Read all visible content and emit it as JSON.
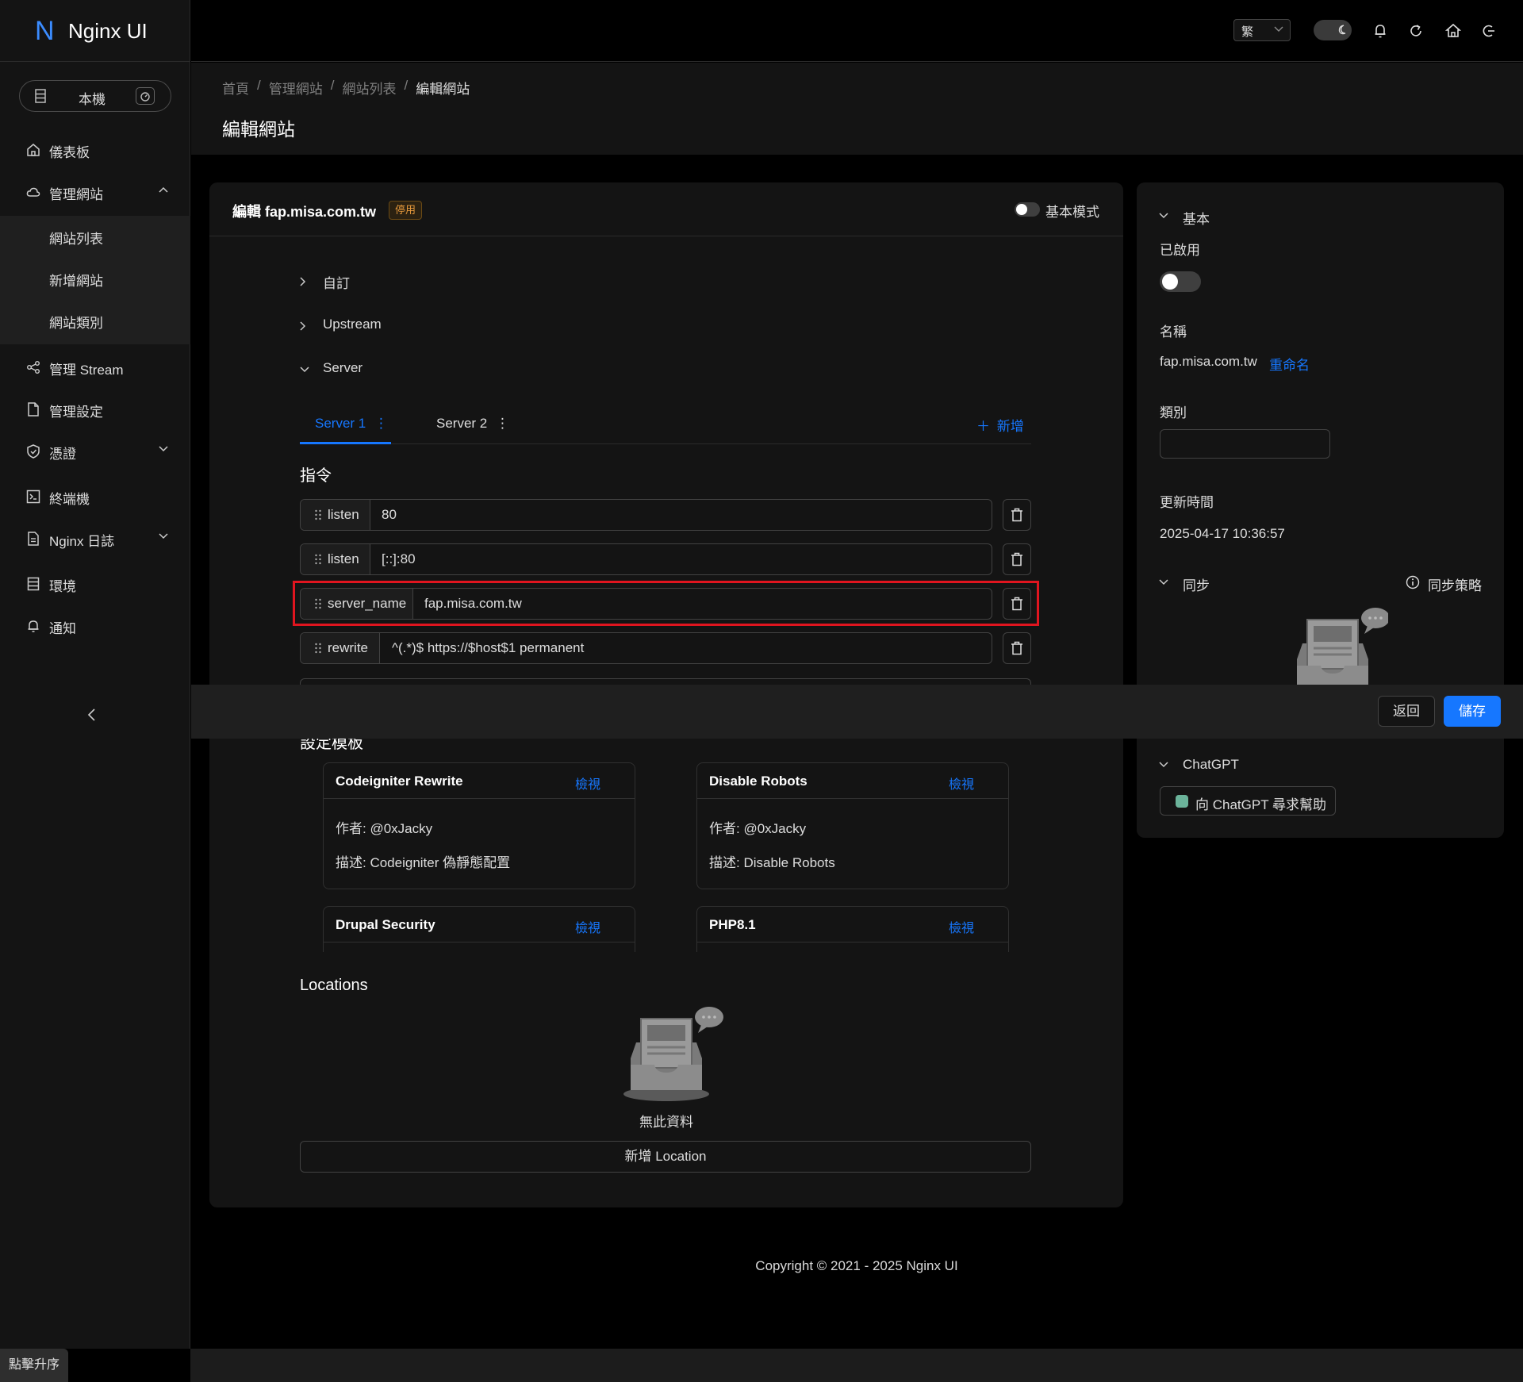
{
  "app": {
    "logo_letter": "N",
    "name": "Nginx UI"
  },
  "node_switch": {
    "label": "本機"
  },
  "sidebar": {
    "items": [
      {
        "label": "儀表板",
        "icon": "home-icon"
      },
      {
        "label": "管理網站",
        "icon": "cloud-icon",
        "expanded": true,
        "children": [
          {
            "label": "網站列表"
          },
          {
            "label": "新增網站"
          },
          {
            "label": "網站類別"
          }
        ]
      },
      {
        "label": "管理 Stream",
        "icon": "share-icon"
      },
      {
        "label": "管理設定",
        "icon": "file-icon"
      },
      {
        "label": "憑證",
        "icon": "shield-icon"
      },
      {
        "label": "終端機",
        "icon": "terminal-icon"
      },
      {
        "label": "Nginx 日誌",
        "icon": "file-text-icon"
      },
      {
        "label": "環境",
        "icon": "database-icon"
      },
      {
        "label": "通知",
        "icon": "bell-icon"
      }
    ],
    "collapse_icon": "chevron-left-icon"
  },
  "header": {
    "language": "繁",
    "icons": [
      "moon-icon",
      "bell-icon",
      "reload-icon",
      "home-icon",
      "logout-icon"
    ]
  },
  "breadcrumb": [
    "首頁",
    "管理網站",
    "網站列表",
    "編輯網站"
  ],
  "page_title": "編輯網站",
  "editor": {
    "title": "編輯 fap.misa.com.tw",
    "status_tag": "停用",
    "basic_mode_label": "基本模式",
    "basic_mode_on": false,
    "collapses": [
      {
        "label": "自訂",
        "expanded": false
      },
      {
        "label": "Upstream",
        "expanded": false
      },
      {
        "label": "Server",
        "expanded": true
      }
    ],
    "tabs": [
      {
        "label": "Server 1",
        "active": true
      },
      {
        "label": "Server 2",
        "active": false
      }
    ],
    "add_tab_label": "新增",
    "directives_title": "指令",
    "directives": [
      {
        "name": "listen",
        "value": "80"
      },
      {
        "name": "listen",
        "value": "[::]:80"
      },
      {
        "name": "server_name",
        "value": "fap.misa.com.tw",
        "highlighted": true
      },
      {
        "name": "rewrite",
        "value": "^(.*)$ https://$host$1 permanent"
      }
    ],
    "templates_title": "設定模板",
    "templates": [
      {
        "name": "Codeigniter Rewrite",
        "link": "檢視",
        "author": "作者: @0xJacky",
        "desc": "描述: Codeigniter 偽靜態配置"
      },
      {
        "name": "Disable Robots",
        "link": "檢視",
        "author": "作者: @0xJacky",
        "desc": "描述: Disable Robots"
      },
      {
        "name": "Drupal Security",
        "link": "檢視"
      },
      {
        "name": "PHP8.1",
        "link": "檢視"
      }
    ],
    "locations_title": "Locations",
    "locations_empty": "無此資料",
    "add_location_label": "新增 Location"
  },
  "actions": {
    "back_label": "返回",
    "save_label": "儲存"
  },
  "side": {
    "basic_title": "基本",
    "enabled_label": "已啟用",
    "enabled": false,
    "name_label": "名稱",
    "name_value": "fap.misa.com.tw",
    "rename_label": "重命名",
    "category_label": "類別",
    "category_value": "",
    "updated_label": "更新時間",
    "updated_value": "2025-04-17 10:36:57",
    "sync_title": "同步",
    "sync_policy_label": "同步策略",
    "chatgpt_title": "ChatGPT",
    "chatgpt_button": "向 ChatGPT 尋求幫助"
  },
  "footer": {
    "copyright": "Copyright © 2021 - 2025 Nginx UI"
  },
  "upgrade_label": "點擊升序",
  "colors": {
    "primary": "#1677ff",
    "danger_highlight": "#e0151f",
    "warning_tag": "#e89a3c",
    "background": "#000000",
    "card": "#141414"
  }
}
